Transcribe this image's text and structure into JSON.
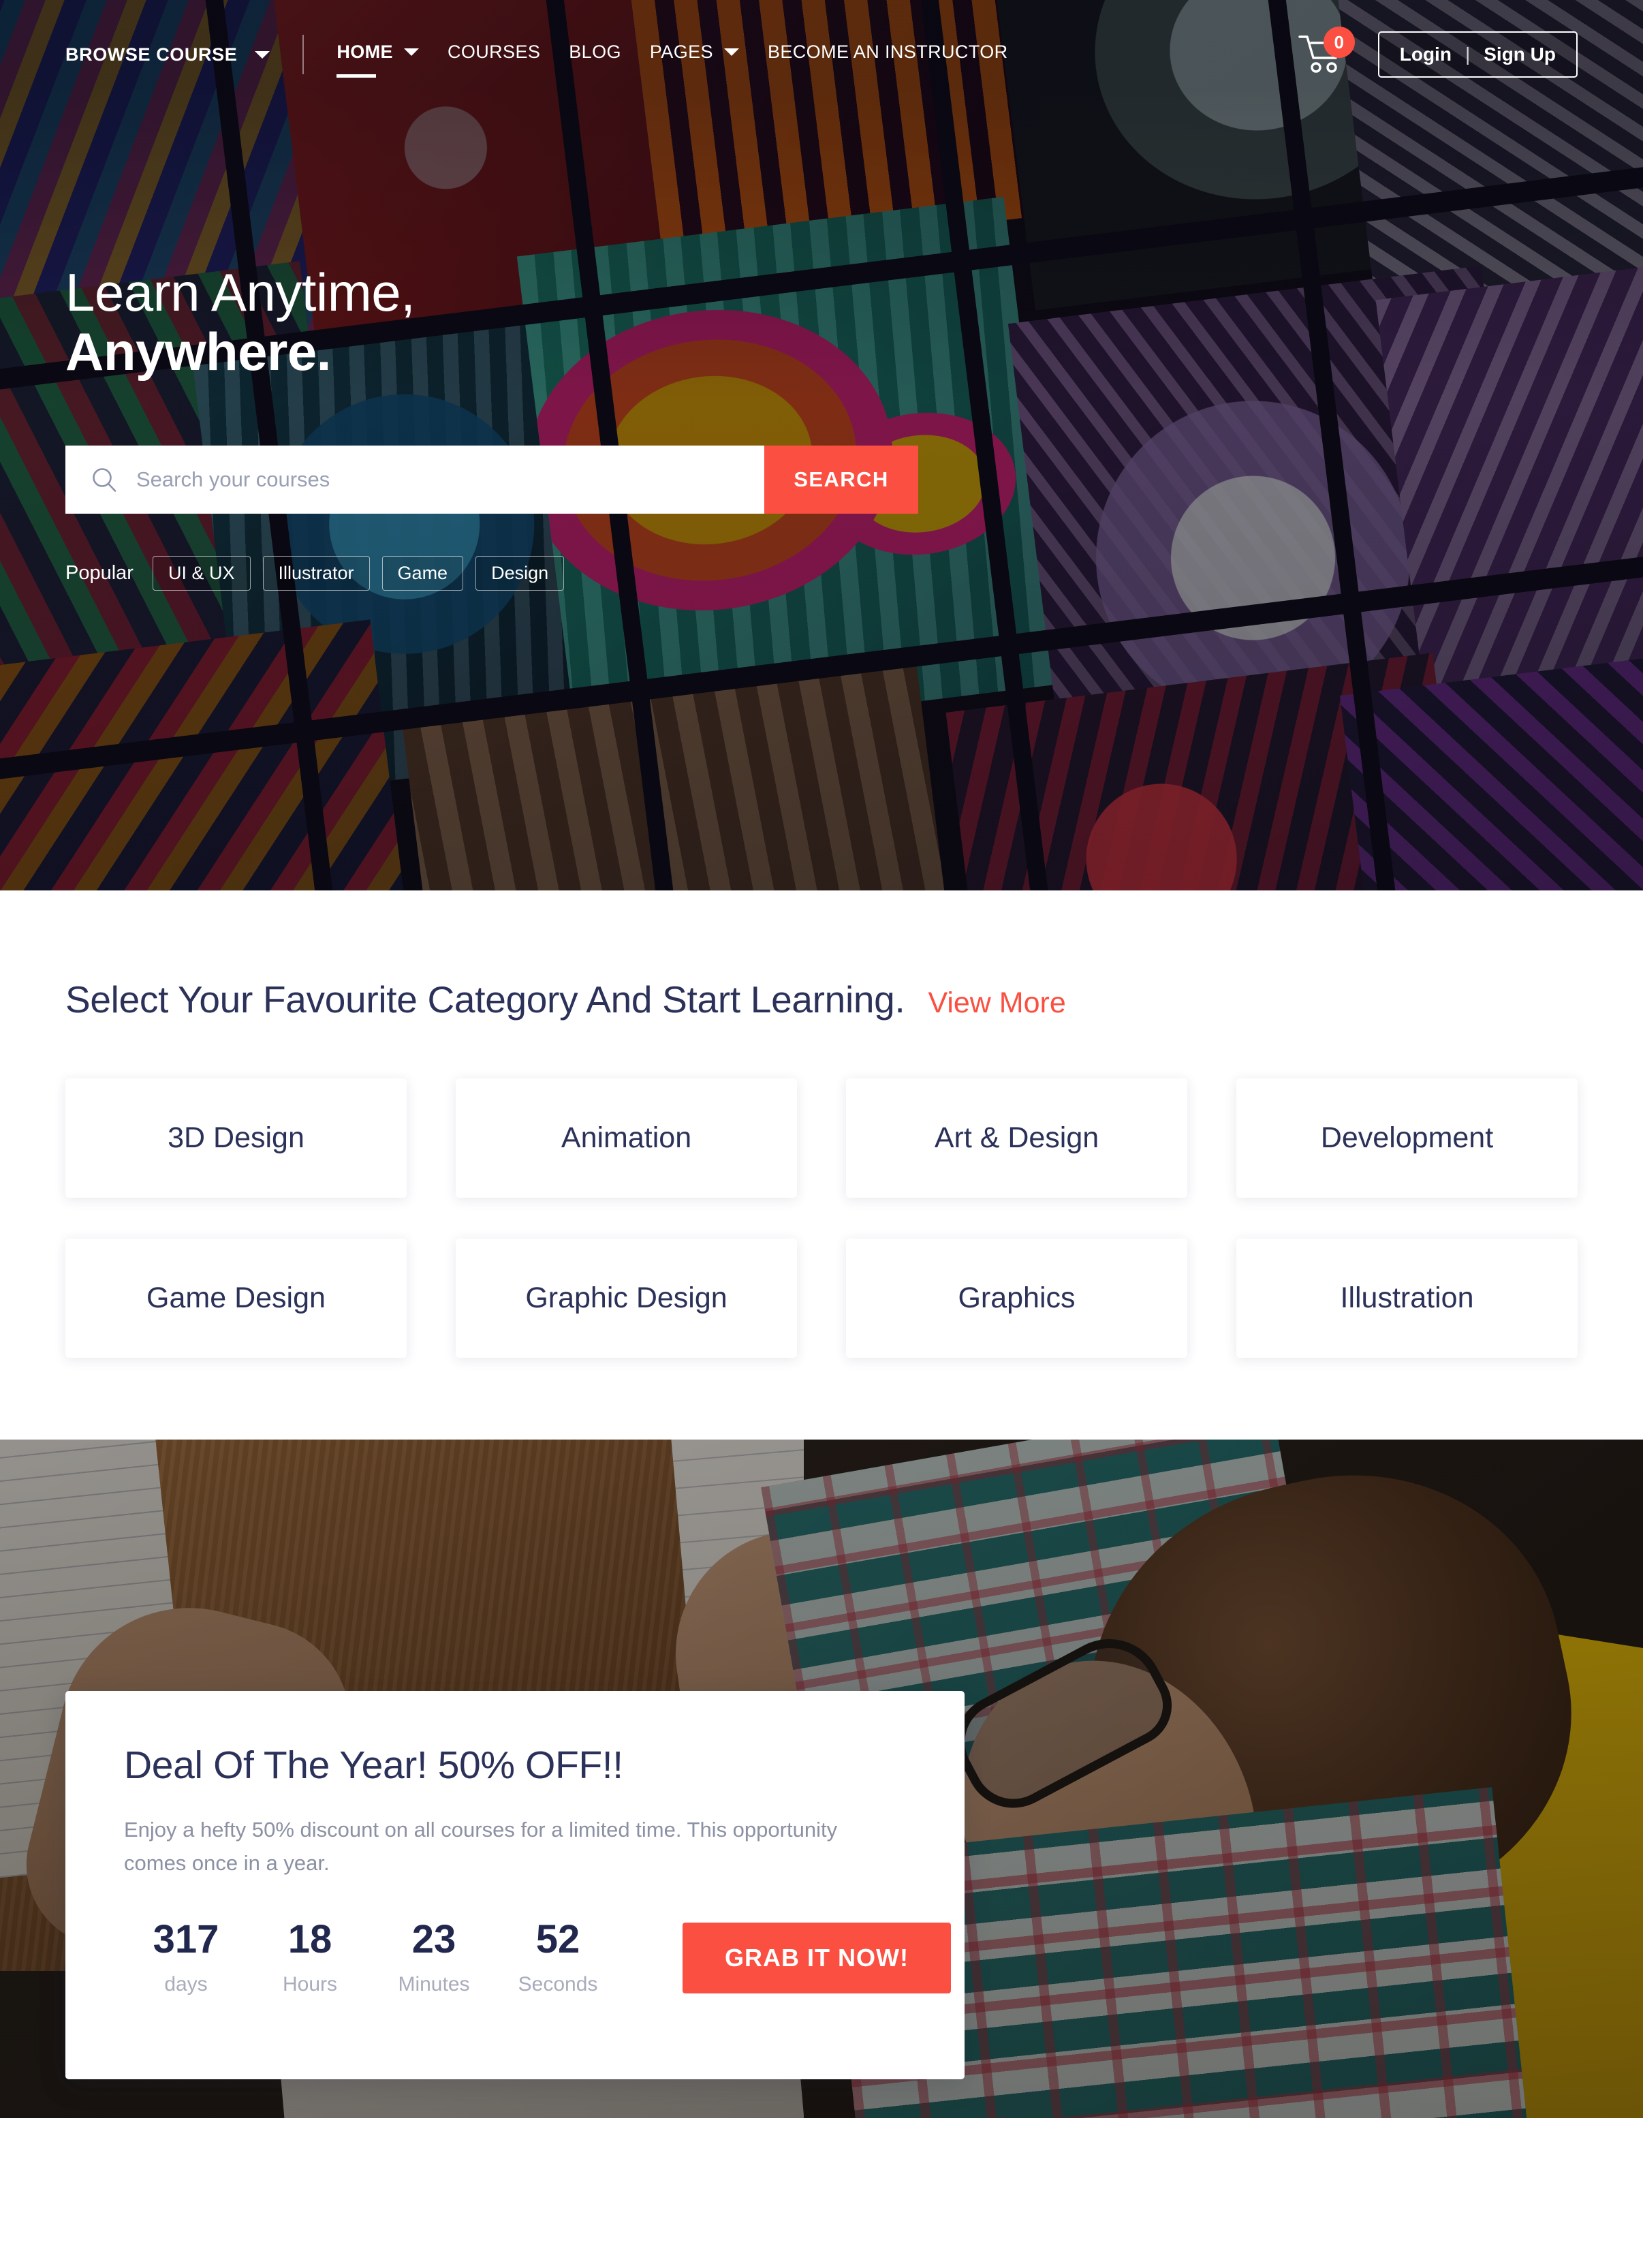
{
  "navbar": {
    "browse_course": "BROWSE COURSE",
    "browse_caret_icon": "chevron-down-icon",
    "items": [
      {
        "label": "HOME",
        "active": true,
        "caret": true
      },
      {
        "label": "COURSES",
        "active": false,
        "caret": false
      },
      {
        "label": "BLOG",
        "active": false,
        "caret": false
      },
      {
        "label": "PAGES",
        "active": false,
        "caret": true
      },
      {
        "label": "BECOME AN INSTRUCTOR",
        "active": false,
        "caret": false
      }
    ],
    "cart_icon": "shopping-cart-icon",
    "cart_count": "0",
    "login_label": "Login",
    "auth_separator": "|",
    "signup_label": "Sign Up"
  },
  "hero": {
    "title_line1": "Learn Anytime,",
    "title_line2": "Anywhere.",
    "search_icon": "search-icon",
    "search_placeholder": "Search your courses",
    "search_value": "",
    "search_button": "SEARCH",
    "popular_label": "Popular",
    "tags": [
      "UI & UX",
      "Illustrator",
      "Game",
      "Design"
    ]
  },
  "categories": {
    "title": "Select Your Favourite Category And Start Learning.",
    "view_more": "View More",
    "items": [
      "3D Design",
      "Animation",
      "Art & Design",
      "Development",
      "Game Design",
      "Graphic Design",
      "Graphics",
      "Illustration"
    ]
  },
  "deal": {
    "title": "Deal Of The Year! 50% OFF!!",
    "description": "Enjoy a hefty 50% discount on all courses for a limited time. This opportunity comes once in a year.",
    "countdown": [
      {
        "value": "317",
        "label": "days"
      },
      {
        "value": "18",
        "label": "Hours"
      },
      {
        "value": "23",
        "label": "Minutes"
      },
      {
        "value": "52",
        "label": "Seconds"
      }
    ],
    "cta": "GRAB IT NOW!"
  },
  "colors": {
    "accent": "#fb4f41",
    "heading": "#2b3159",
    "muted": "#8b90a3",
    "countdown_num": "#22284d",
    "countdown_lbl": "#a8acbb"
  }
}
